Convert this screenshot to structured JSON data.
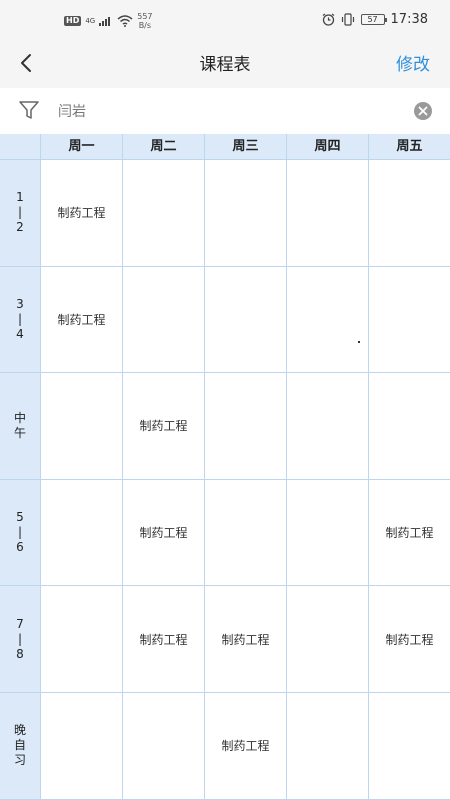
{
  "status_bar": {
    "hd": "HD",
    "network": "4G",
    "speed_value": "557",
    "speed_unit": "B/s",
    "battery": "57",
    "time": "17:38"
  },
  "title_bar": {
    "title": "课程表",
    "edit_label": "修改"
  },
  "filter": {
    "value": "闫岩"
  },
  "timetable": {
    "days": [
      "周一",
      "周二",
      "周三",
      "周四",
      "周五"
    ],
    "periods": [
      "1\n|\n2",
      "3\n|\n4",
      "中\n午",
      "5\n|\n6",
      "7\n|\n8",
      "晚\n自\n习"
    ],
    "cells": [
      [
        "制药工程",
        "",
        "",
        "",
        ""
      ],
      [
        "制药工程",
        "",
        "",
        "",
        ""
      ],
      [
        "",
        "制药工程",
        "",
        "",
        ""
      ],
      [
        "",
        "制药工程",
        "",
        "",
        "制药工程"
      ],
      [
        "",
        "制药工程",
        "制药工程",
        "",
        "制药工程"
      ],
      [
        "",
        "",
        "制药工程",
        "",
        ""
      ]
    ]
  },
  "colors": {
    "accent": "#2f8fdd",
    "header_bg": "#dbe9f9",
    "grid_line": "#bcd6ee"
  }
}
